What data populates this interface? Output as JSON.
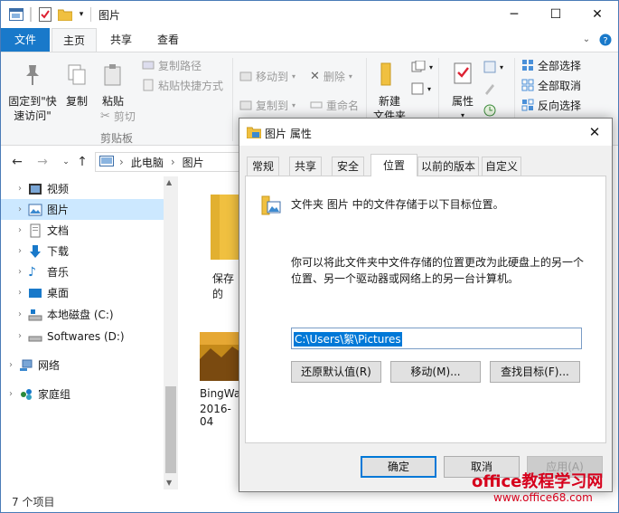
{
  "window": {
    "title": "图片",
    "minimize": "─",
    "maximize": "☐",
    "close": "✕"
  },
  "ribbon_tabs": [
    {
      "label": "文件"
    },
    {
      "label": "主页"
    },
    {
      "label": "共享"
    },
    {
      "label": "查看"
    }
  ],
  "ribbon": {
    "pin_label_1": "固定到\"快",
    "pin_label_2": "速访问\"",
    "copy": "复制",
    "paste": "粘贴",
    "copy_path": "复制路径",
    "paste_shortcut": "粘贴快捷方式",
    "cut": "剪切",
    "clipboard_group": "剪贴板",
    "move_to": "移动到",
    "copy_to": "复制到",
    "delete": "删除",
    "rename": "重命名",
    "new_folder_1": "新建",
    "new_folder_2": "文件夹",
    "properties": "属性",
    "select_all": "全部选择",
    "select_none": "全部取消",
    "invert_select": "反向选择"
  },
  "address": {
    "crumbs": [
      "此电脑",
      "图片"
    ],
    "sep": "›"
  },
  "nav": [
    {
      "label": "视频"
    },
    {
      "label": "图片"
    },
    {
      "label": "文档"
    },
    {
      "label": "下载"
    },
    {
      "label": "音乐"
    },
    {
      "label": "桌面"
    },
    {
      "label": "本地磁盘 (C:)"
    },
    {
      "label": "Softwares (D:)"
    },
    {
      "label": "网络"
    },
    {
      "label": "家庭组"
    }
  ],
  "content": {
    "folder_label": "保存的",
    "image_label_1": "BingWa",
    "image_label_2": "2016-04"
  },
  "status": {
    "items": "7 个项目"
  },
  "dialog": {
    "title": "图片 属性",
    "close": "✕",
    "tabs": [
      {
        "label": "常规"
      },
      {
        "label": "共享"
      },
      {
        "label": "安全"
      },
      {
        "label": "位置"
      },
      {
        "label": "以前的版本"
      },
      {
        "label": "自定义"
      }
    ],
    "header_text": "文件夹 图片 中的文件存储于以下目标位置。",
    "desc_line1": "你可以将此文件夹中文件存储的位置更改为此硬盘上的另一个",
    "desc_line2": "位置、另一个驱动器或网络上的另一台计算机。",
    "path_value": "C:\\Users\\絮\\Pictures",
    "restore_btn": "还原默认值(R)",
    "move_btn": "移动(M)...",
    "find_btn": "查找目标(F)...",
    "ok_btn": "确定",
    "cancel_btn": "取消",
    "apply_btn": "应用(A)"
  },
  "watermark": {
    "line1": "office教程学习网",
    "line2": "www.office68.com"
  },
  "colors": {
    "accent": "#1979ca",
    "selection": "#cce8ff",
    "folder": "#f0c040",
    "watermark": "#d6001c"
  }
}
